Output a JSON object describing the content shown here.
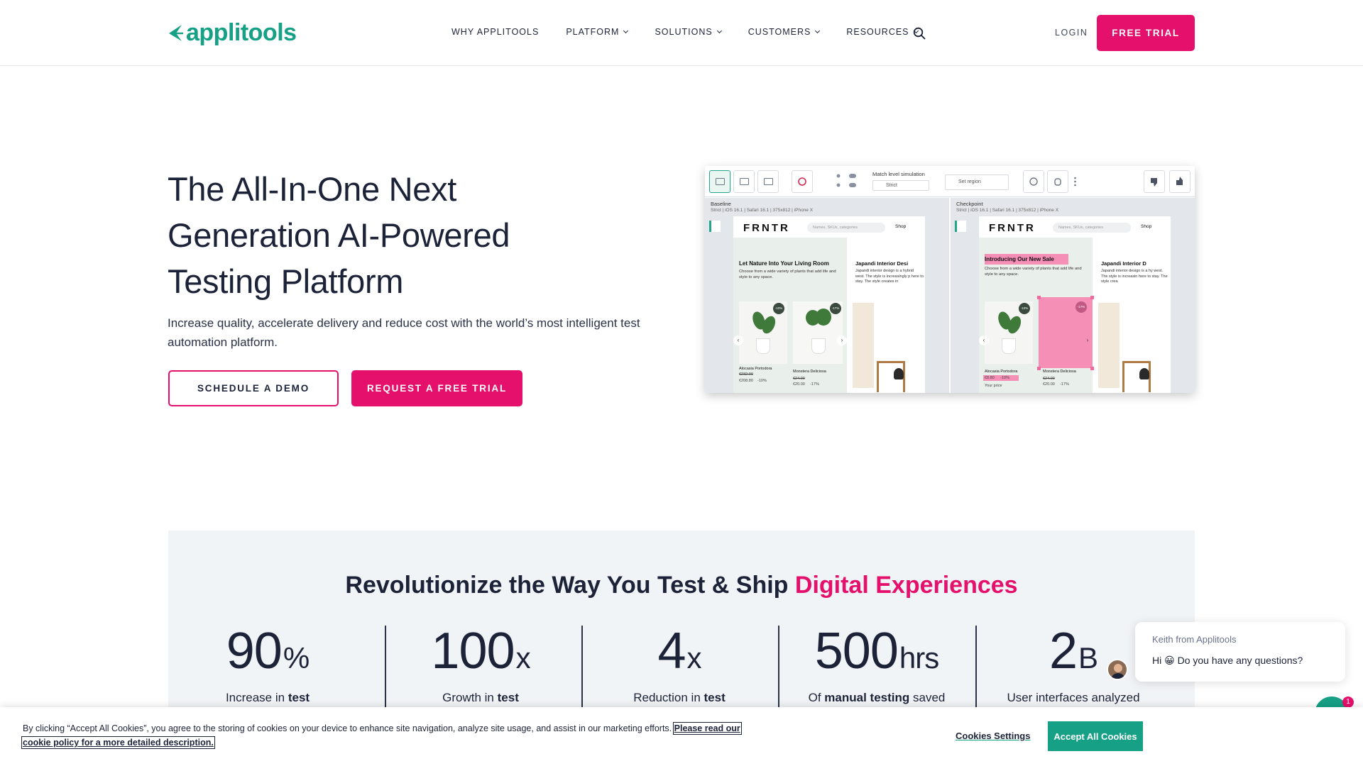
{
  "header": {
    "logo_text": "applitools",
    "nav": [
      {
        "label": "WHY APPLITOOLS",
        "has_dropdown": false
      },
      {
        "label": "PLATFORM",
        "has_dropdown": true
      },
      {
        "label": "SOLUTIONS",
        "has_dropdown": true
      },
      {
        "label": "CUSTOMERS",
        "has_dropdown": true
      },
      {
        "label": "RESOURCES",
        "has_dropdown": true
      }
    ],
    "search_icon": "search-icon",
    "login_label": "LOGIN",
    "trial_label": "FREE TRIAL"
  },
  "hero": {
    "title": "The All-In-One Next Generation AI-Powered Testing Platform",
    "subtitle": "Increase quality, accelerate delivery and reduce cost with the world’s most intelligent test automation platform.",
    "demo_label": "SCHEDULE A DEMO",
    "request_label": "REQUEST A FREE TRIAL"
  },
  "product_shot": {
    "match_label": "Match level simulation",
    "match_value": "Strict",
    "region_label": "Set region",
    "baseline": {
      "title": "Baseline",
      "meta": "Strict | iOS 16.1 | Safari 16.1 | 375x812 | iPhone X",
      "brand": "FRNTR",
      "search_placeholder": "Names, SKUs, categories",
      "shop": "Shop",
      "card_title": "Let Nature Into Your Living Room",
      "card_text": "Choose from a wide variety of plants that add life and style to any space.",
      "side_title": "Japandi Interior Desi",
      "side_text": "Japandi interior design is a hybrid west. The style is increasingly p here to stay. The style creates in",
      "badge1": "-10%",
      "badge2": "-17%",
      "prod1_name": "Alocasia Portodora",
      "prod1_old": "€232.00",
      "prod1_price": "€208.80",
      "prod1_off": "-10%",
      "prod2_name": "Monstera Deliciosa",
      "prod2_old": "€24.00",
      "prod2_price": "€20.00",
      "prod2_off": "-17%"
    },
    "checkpoint": {
      "title": "Checkpoint",
      "meta": "Strict | iOS 16.1 | Safari 16.1 | 375x812 | iPhone X",
      "brand": "FRNTR",
      "search_placeholder": "Names, SKUs, categories",
      "shop": "Shop",
      "card_title": "Introducing Our New Sale",
      "card_text": "Choose from a wide variety of plants that add life and style to any space.",
      "side_title": "Japandi Interior D",
      "side_text": "Japandi interior design is a hy west. The style is increasin here to stay. The style crea",
      "badge1": "-10%",
      "badge2": "-17%",
      "prod1_name": "Alocasia Portodora",
      "prod1_price": "€8.80",
      "prod1_off": "-10%",
      "prod1_tag": "Your price",
      "prod2_name": "Monstera Deliciosa",
      "prod2_old": "€24.00",
      "prod2_price": "€20.00",
      "prod2_off": "-17%"
    }
  },
  "stats": {
    "title_plain": "Revolutionize the Way You Test & Ship ",
    "title_accent": "Digital Experiences",
    "items": [
      {
        "num": "90",
        "unit": "%",
        "pre": "Increase in ",
        "bold": "test",
        "post": ""
      },
      {
        "num": "100",
        "unit": "x",
        "pre": "Growth in ",
        "bold": "test",
        "post": ""
      },
      {
        "num": "4",
        "unit": "x",
        "pre": "Reduction in ",
        "bold": "test",
        "post": ""
      },
      {
        "num": "500",
        "unit": "hrs",
        "pre": "Of ",
        "bold": "manual testing",
        "post": " saved"
      },
      {
        "num": "2",
        "unit": "B",
        "pre": "User interfaces analyzed",
        "bold": "",
        "post": ""
      }
    ]
  },
  "chat": {
    "from": "Keith from Applitools",
    "message": "Hi 😀  Do you have any questions?",
    "unread_count": "1"
  },
  "cookie": {
    "text": "By clicking “Accept All Cookies”, you agree to the storing of cookies on your device to enhance site navigation, analyze site usage, and assist in our marketing efforts. ",
    "link": "Please read our cookie policy for a more detailed description.",
    "settings_label": "Cookies Settings",
    "accept_label": "Accept All Cookies"
  },
  "colors": {
    "brand_pink": "#e5106b",
    "brand_teal": "#16a085",
    "text_navy": "#1c2339"
  }
}
